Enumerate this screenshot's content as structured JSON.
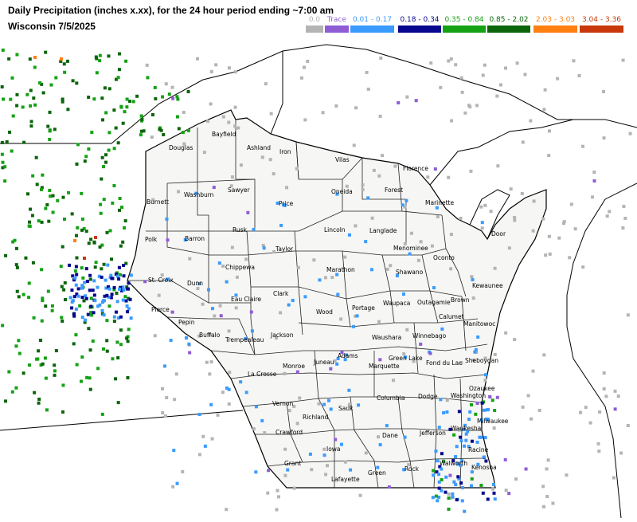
{
  "header": {
    "title": "Daily Precipitation (inches  x.xx),  for the 24 hour period ending ~7:00 am",
    "subtitle": "Wisconsin 7/5/2025"
  },
  "legend": [
    {
      "label": "0.0",
      "color": "#b4b4b4"
    },
    {
      "label": "Trace",
      "color": "#8f5cd6"
    },
    {
      "label": "0.01 - 0.17",
      "color": "#3a9bff"
    },
    {
      "label": "0.18 - 0.34",
      "color": "#06068f"
    },
    {
      "label": "0.35 - 0.84",
      "color": "#14a214"
    },
    {
      "label": "0.85 - 2.02",
      "color": "#0b650b"
    },
    {
      "label": "2.03 - 3.03",
      "color": "#ff7f11"
    },
    {
      "label": "3.04 - 3.36",
      "color": "#c8380a"
    }
  ],
  "counties": [
    "Douglas",
    "Bayfield",
    "Ashland",
    "Iron",
    "Vilas",
    "Florence",
    "Burnett",
    "Washburn",
    "Sawyer",
    "Oneida",
    "Forest",
    "Marinette",
    "Price",
    "Polk",
    "Barron",
    "Rusk",
    "Lincoln",
    "Langlade",
    "Menominee",
    "Oconto",
    "Taylor",
    "Door",
    "Chippewa",
    "Marathon",
    "Shawano",
    "Kewaunee",
    "St. Croix",
    "Dunn",
    "Eau Claire",
    "Clark",
    "Wood",
    "Portage",
    "Waupaca",
    "Outagamie",
    "Brown",
    "Pierce",
    "Pepin",
    "Buffalo",
    "Manitowoc",
    "Trempealeau",
    "Jackson",
    "Waushara",
    "Winnebago",
    "Calumet",
    "Juneau",
    "Adams",
    "Sheboygan",
    "La Crosse",
    "Monroe",
    "Green Lake",
    "Fond du Lac",
    "Marquette",
    "Ozaukee",
    "Vernon",
    "Richland",
    "Sauk",
    "Columbia",
    "Dodge",
    "Washington",
    "Milwaukee",
    "Waukesha",
    "Crawford",
    "Jefferson",
    "Iowa",
    "Dane",
    "Grant",
    "Racine",
    "Walworth",
    "Kenosha",
    "Lafayette",
    "Green",
    "Rock"
  ]
}
